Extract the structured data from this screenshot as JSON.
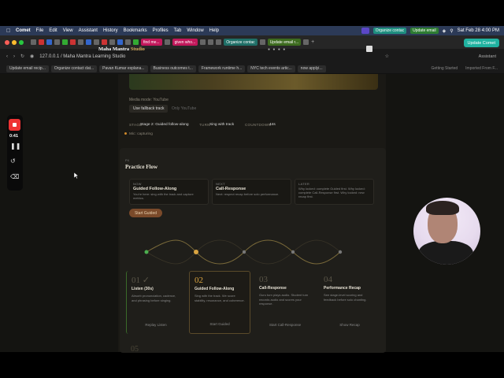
{
  "menubar": {
    "app": "Comet",
    "items": [
      "File",
      "Edit",
      "View",
      "Assistant",
      "History",
      "Bookmarks",
      "Profiles",
      "Tab",
      "Window",
      "Help"
    ],
    "chips": [
      "Organize contac",
      "Update email"
    ],
    "datetime": "Sat Feb 28  4:00 PM"
  },
  "browser": {
    "tab_pills": [
      "find me...",
      "given who...",
      "Organize contac",
      "Update email r..."
    ],
    "update_button": "Update Comet",
    "url": "127.0.0.1 / Maha Mantra Learning Studio",
    "assistant": "Assistant",
    "bookmarks": [
      "Update email recip...",
      "Organize contact dat...",
      "Pavan Kumar explana...",
      "Business outcomes t...",
      "Framework runtime h...",
      "NYC tech events artic...",
      "now applyi..."
    ],
    "bookmarks_right": [
      "Getting Started",
      "Imported From F..."
    ]
  },
  "hero": {
    "title_main": "Maha Mantra",
    "title_gold": "Studio",
    "dots": "● ● ● ●"
  },
  "media": {
    "label": "Media mode: YouTube",
    "fallback_button": "Use fallback track",
    "alt": "Only YouTube"
  },
  "stats": {
    "stage_key": "STAGE",
    "stage_val": "Stage 2: Guided follow-along",
    "turn_key": "TURN",
    "turn_val": "Sing with track",
    "countdown_key": "COUNTDOWN",
    "countdown_val": "44s",
    "mic": "Mic: capturing"
  },
  "flow": {
    "eyebrow": "P4",
    "title": "Practice Flow",
    "now": {
      "k": "NOW",
      "t": "Guided Follow-Along",
      "d": "You're here: sing with the track and capture metrics."
    },
    "next": {
      "k": "NEXT",
      "t": "Call-Response",
      "d": "Next: respect recap before solo performance."
    },
    "later": {
      "k": "LATER",
      "t": "",
      "d": "Why locked: complete Guided first. Why locked: complete Call-Response first. Why locked: new recap first."
    },
    "start": "Start Guided"
  },
  "stages": [
    {
      "num": "01 ✓",
      "name": "Listen (30s)",
      "desc": "Absorb pronunciation, cadence, and phrasing before singing.",
      "btn": "Replay Listen"
    },
    {
      "num": "02",
      "name": "Guided Follow-Along",
      "desc": "Sing with the track. We score stability, resonance, and coherence.",
      "btn": "Start Guided"
    },
    {
      "num": "03",
      "name": "Call-Response",
      "desc": "Guru turn plays audio. Student turn records audio and scores your response.",
      "btn": "Start Call-Response"
    },
    {
      "num": "04",
      "name": "Performance Recap",
      "desc": "See stage-level scoring and feedback before solo chanting.",
      "btn": "Show Recap"
    }
  ],
  "bottom_num": "05",
  "recorder": {
    "time": "0:41"
  },
  "colors": {
    "accent": "#d9a441",
    "menubar": "#2c3a57",
    "update": "#20b2a0",
    "rec": "#ee3333"
  }
}
